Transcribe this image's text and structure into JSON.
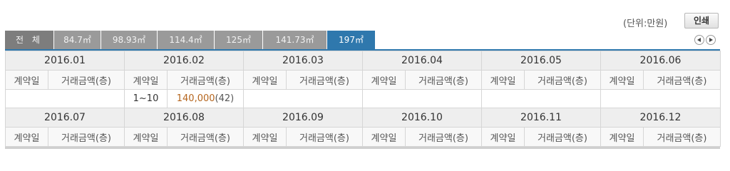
{
  "unit_label": "(단위:만원)",
  "print_button": "인쇄",
  "tabs": [
    {
      "label": "전 체"
    },
    {
      "label": "84.7㎡"
    },
    {
      "label": "98.93㎡"
    },
    {
      "label": "114.4㎡"
    },
    {
      "label": "125㎡"
    },
    {
      "label": "141.73㎡"
    },
    {
      "label": "197㎡"
    }
  ],
  "active_tab": "197㎡",
  "colors": {
    "accent": "#2f78ad",
    "price": "#b5651d",
    "tab_bg": "#9a9a9a"
  },
  "col_headers": {
    "date": "계약일",
    "amount": "거래금액(층)"
  },
  "row1": {
    "months": [
      "2016.01",
      "2016.02",
      "2016.03",
      "2016.04",
      "2016.05",
      "2016.06"
    ],
    "records": [
      {
        "month": "2016.02",
        "date": "1~10",
        "price": "140,000",
        "floor": "(42)"
      }
    ]
  },
  "row2": {
    "months": [
      "2016.07",
      "2016.08",
      "2016.09",
      "2016.10",
      "2016.11",
      "2016.12"
    ]
  },
  "nav": {
    "prev_icon": "arrow-left-icon",
    "next_icon": "arrow-right-icon"
  }
}
